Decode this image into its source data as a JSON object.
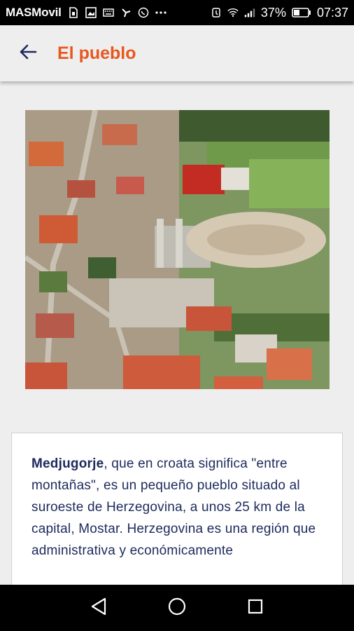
{
  "status_bar": {
    "carrier": "MASMovil",
    "battery": "37%",
    "time": "07:37",
    "icons": [
      "sim-icon",
      "phone-icon",
      "image-icon",
      "keyboard-icon",
      "wind-icon",
      "whatsapp-icon",
      "more-icon",
      "alarm-icon",
      "wifi-icon",
      "signal-icon",
      "battery-icon"
    ]
  },
  "app_bar": {
    "back_icon": "arrow-left-icon",
    "title": "El pueblo",
    "accent_color": "#e8571e"
  },
  "main": {
    "image": "aerial-photo-medjugorje",
    "description": {
      "bold": "Medjugorje",
      "text": ", que en croata significa \"entre montañas\", es un pequeño pueblo situado al suroeste de Herzegovina, a unos 25 km de la capital, Mostar. Herzegovina es una región que administrativa y económicamente"
    }
  },
  "nav_bar": {
    "back": "back-triangle-icon",
    "home": "home-circle-icon",
    "recents": "recents-square-icon"
  }
}
